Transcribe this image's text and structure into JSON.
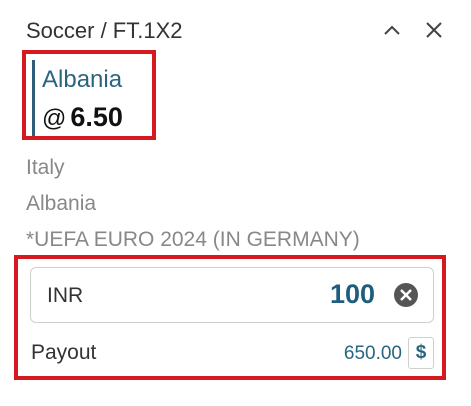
{
  "header": {
    "title": "Soccer / FT.1X2"
  },
  "selection": {
    "name": "Albania",
    "odds_prefix": "@",
    "odds": "6.50"
  },
  "event": {
    "home": "Italy",
    "away": "Albania",
    "league": "*UEFA EURO 2024 (IN GERMANY)"
  },
  "stake": {
    "currency": "INR",
    "amount": "100"
  },
  "payout": {
    "label": "Payout",
    "value": "650.00",
    "currency_symbol": "$"
  },
  "colors": {
    "accent": "#2a6580",
    "highlight_border": "#d6181f"
  }
}
